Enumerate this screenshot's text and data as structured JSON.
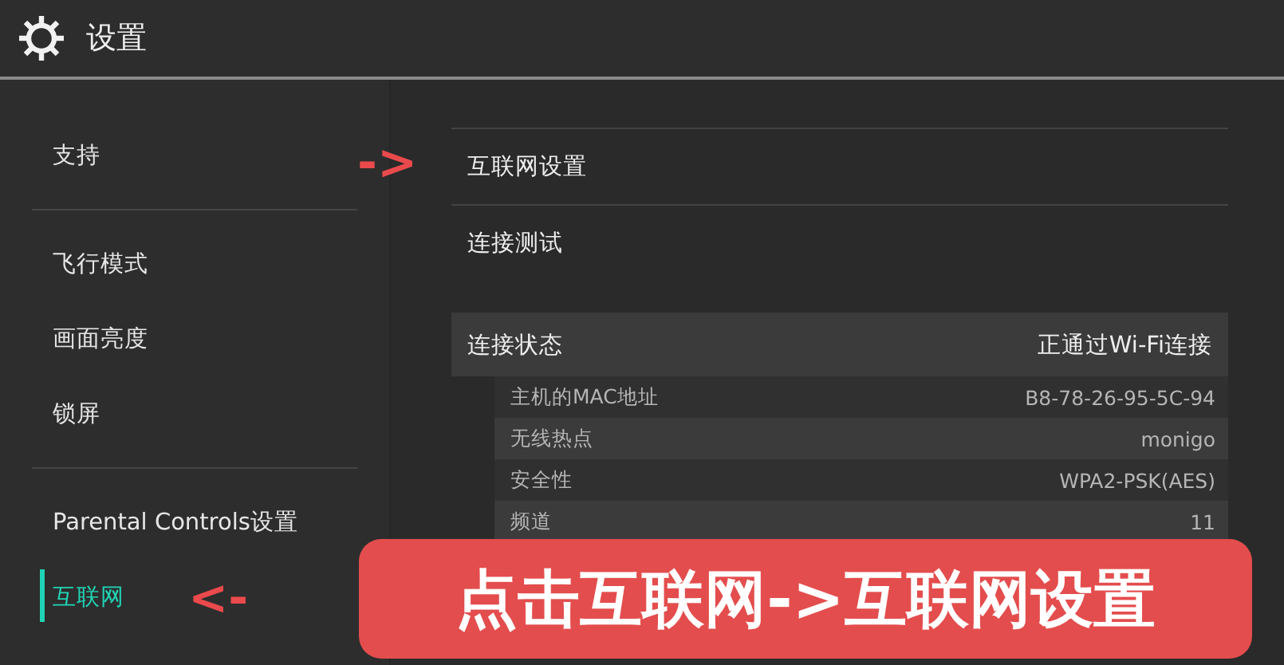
{
  "header": {
    "title": "设置"
  },
  "sidebar": {
    "groups": [
      [
        {
          "label": "支持",
          "selected": false
        }
      ],
      [
        {
          "label": "飞行模式",
          "selected": false
        },
        {
          "label": "画面亮度",
          "selected": false
        },
        {
          "label": "锁屏",
          "selected": false
        }
      ],
      [
        {
          "label": "Parental Controls设置",
          "selected": false
        },
        {
          "label": "互联网",
          "selected": true
        }
      ]
    ]
  },
  "main": {
    "menu": [
      {
        "label": "互联网设置"
      },
      {
        "label": "连接测试"
      }
    ],
    "status": {
      "label": "连接状态",
      "value": "正通过Wi-Fi连接",
      "details": [
        {
          "label": "主机的MAC地址",
          "value": "B8-78-26-95-5C-94"
        },
        {
          "label": "无线热点",
          "value": "monigo"
        },
        {
          "label": "安全性",
          "value": "WPA2-PSK(AES)"
        },
        {
          "label": "频道",
          "value": "11"
        }
      ]
    }
  },
  "annotations": {
    "arrows": [
      {
        "text": "->",
        "kind": "right"
      },
      {
        "text": "<-",
        "kind": "left"
      }
    ],
    "banner": {
      "text": "点击互联网->互联网设置"
    }
  }
}
